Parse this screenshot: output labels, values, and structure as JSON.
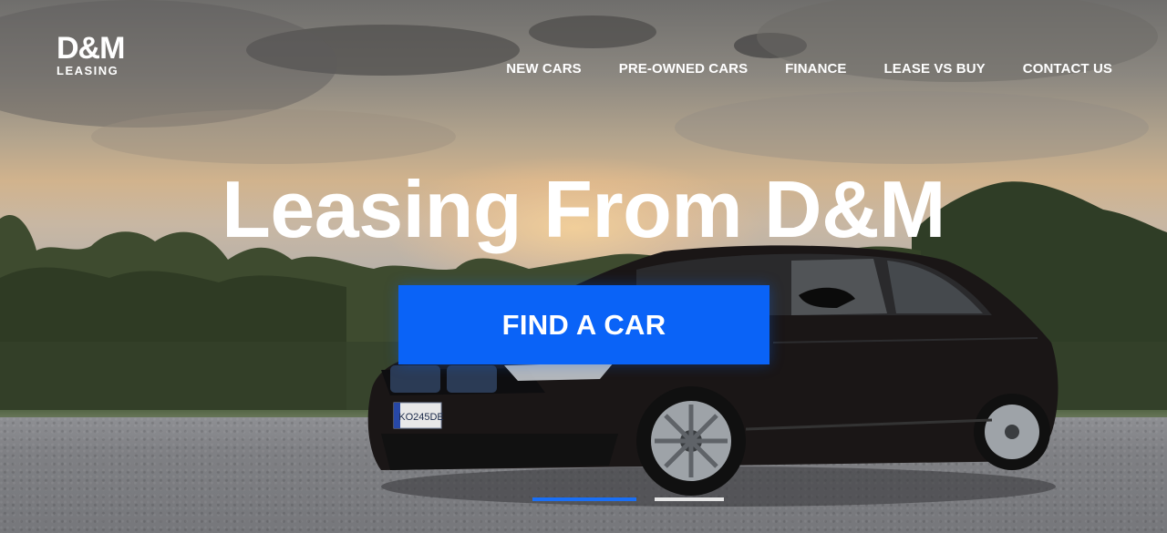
{
  "brand": {
    "logo_mark": "D&M",
    "logo_sub": "LEASING"
  },
  "nav": {
    "items": [
      {
        "label": "NEW CARS"
      },
      {
        "label": "PRE-OWNED CARS"
      },
      {
        "label": "FINANCE"
      },
      {
        "label": "LEASE VS BUY"
      },
      {
        "label": "CONTACT US"
      }
    ]
  },
  "hero": {
    "headline": "Leasing From D&M",
    "cta_label": "FIND A CAR",
    "license_plate": "KO245DE",
    "slides_total": 2,
    "active_slide": 1
  },
  "colors": {
    "accent": "#0A63F7",
    "text": "#FFFFFF",
    "slider_inactive": "#E6E6E6"
  },
  "icons": [
    "car-photo",
    "logo"
  ]
}
